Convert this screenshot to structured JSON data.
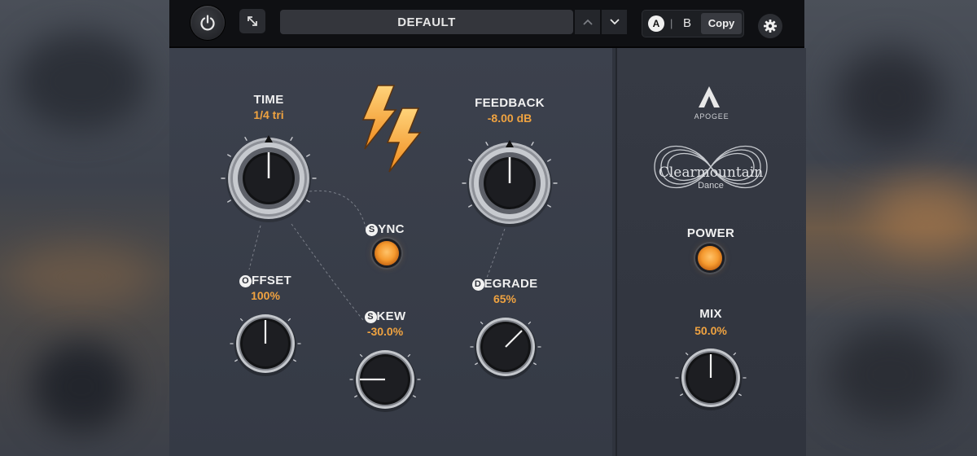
{
  "topbar": {
    "preset_name": "DEFAULT",
    "ab_a": "A",
    "ab_separator": "|",
    "ab_b": "B",
    "copy_label": "Copy"
  },
  "knobs": {
    "time": {
      "label": "TIME",
      "value": "1/4 tri"
    },
    "feedback": {
      "label": "FEEDBACK",
      "value": "-8.00 dB"
    },
    "offset": {
      "label_initial": "O",
      "label_rest": "FFSET",
      "value": "100%"
    },
    "skew": {
      "label_initial": "S",
      "label_rest": "KEW",
      "value": "-30.0%"
    },
    "degrade": {
      "label_initial": "D",
      "label_rest": "EGRADE",
      "value": "65%"
    },
    "mix": {
      "label": "MIX",
      "value": "50.0%"
    }
  },
  "sync": {
    "label_initial": "S",
    "label_rest": "YNC"
  },
  "brand": {
    "maker": "APOGEE",
    "product": "Clearmountain",
    "product_sub": "Dance"
  },
  "power": {
    "label": "POWER"
  },
  "colors": {
    "accent": "#f0a340",
    "panel": "#3a3f4b",
    "topbar": "#0f1013"
  },
  "icons": {
    "power": "power-icon",
    "resize": "resize-icon",
    "up": "chevron-up-icon",
    "down": "chevron-down-icon",
    "settings": "gear-icon",
    "logo": "lightning-bolts-icon"
  }
}
